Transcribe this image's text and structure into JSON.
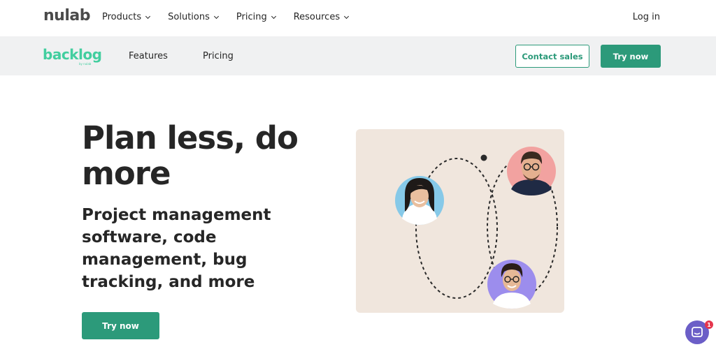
{
  "top_nav": {
    "logo": "nulab",
    "items": [
      {
        "label": "Products"
      },
      {
        "label": "Solutions"
      },
      {
        "label": "Pricing"
      },
      {
        "label": "Resources"
      }
    ],
    "login_label": "Log in"
  },
  "product_nav": {
    "logo": "backlog",
    "logo_byline": "by nulab",
    "features_label": "Features",
    "pricing_label": "Pricing",
    "contact_sales_label": "Contact sales",
    "try_now_label": "Try now"
  },
  "hero": {
    "title": "Plan less, do more",
    "subtitle": "Project management software, code management, bug tracking, and more",
    "cta_label": "Try now"
  },
  "chat": {
    "badge_count": "1"
  },
  "colors": {
    "brand_green": "#2c9a7a",
    "backlog_green": "#42ce9f",
    "subbar_bg": "#f0f1f2",
    "illustration_bg": "#f0e6dd",
    "chat_purple": "#6b5ec7",
    "badge_red": "#e5364d"
  }
}
